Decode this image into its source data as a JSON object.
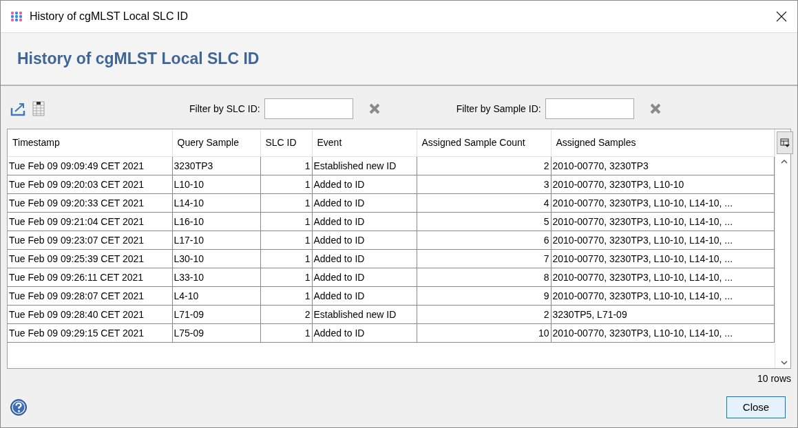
{
  "window": {
    "title": "History of cgMLST Local SLC ID"
  },
  "header": {
    "title": "History of cgMLST Local SLC ID"
  },
  "filters": [
    {
      "label": "Filter by SLC ID:"
    },
    {
      "label": "Filter by Sample ID:"
    }
  ],
  "table": {
    "columns": [
      "Timestamp",
      "Query Sample",
      "SLC ID",
      "Event",
      "Assigned Sample Count",
      "Assigned Samples"
    ],
    "rows": [
      [
        "Tue Feb 09 09:09:49 CET 2021",
        "3230TP3",
        "1",
        "Established new ID",
        "2",
        "2010-00770, 3230TP3"
      ],
      [
        "Tue Feb 09 09:20:03 CET 2021",
        "L10-10",
        "1",
        "Added to ID",
        "3",
        "2010-00770, 3230TP3, L10-10"
      ],
      [
        "Tue Feb 09 09:20:33 CET 2021",
        "L14-10",
        "1",
        "Added to ID",
        "4",
        "2010-00770, 3230TP3, L10-10, L14-10, ..."
      ],
      [
        "Tue Feb 09 09:21:04 CET 2021",
        "L16-10",
        "1",
        "Added to ID",
        "5",
        "2010-00770, 3230TP3, L10-10, L14-10, ..."
      ],
      [
        "Tue Feb 09 09:23:07 CET 2021",
        "L17-10",
        "1",
        "Added to ID",
        "6",
        "2010-00770, 3230TP3, L10-10, L14-10, ..."
      ],
      [
        "Tue Feb 09 09:25:39 CET 2021",
        "L30-10",
        "1",
        "Added to ID",
        "7",
        "2010-00770, 3230TP3, L10-10, L14-10, ..."
      ],
      [
        "Tue Feb 09 09:26:11 CET 2021",
        "L33-10",
        "1",
        "Added to ID",
        "8",
        "2010-00770, 3230TP3, L10-10, L14-10, ..."
      ],
      [
        "Tue Feb 09 09:28:07 CET 2021",
        "L4-10",
        "1",
        "Added to ID",
        "9",
        "2010-00770, 3230TP3, L10-10, L14-10, ..."
      ],
      [
        "Tue Feb 09 09:28:40 CET 2021",
        "L71-09",
        "2",
        "Established new ID",
        "2",
        "3230TP5, L71-09"
      ],
      [
        "Tue Feb 09 09:29:15 CET 2021",
        "L75-09",
        "1",
        "Added to ID",
        "10",
        "2010-00770, 3230TP3, L10-10, L14-10, ..."
      ]
    ]
  },
  "status": {
    "row_count": "10 rows"
  },
  "buttons": [
    {
      "label": "Close"
    }
  ]
}
